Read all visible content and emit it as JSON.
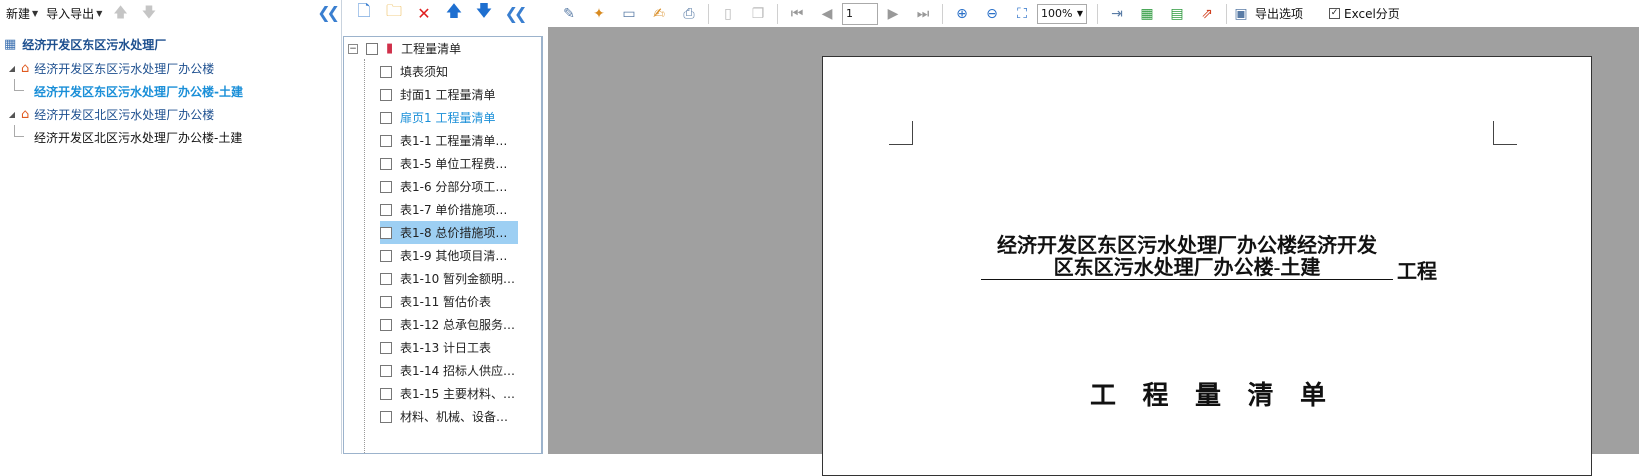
{
  "left": {
    "toolbar": {
      "new_label": "新建",
      "import_export_label": "导入导出"
    },
    "tree": {
      "root": "经济开发区东区污水处理厂",
      "items": [
        {
          "label": "经济开发区东区污水处理厂办公楼"
        },
        {
          "label": "经济开发区东区污水处理厂办公楼-土建"
        },
        {
          "label": "经济开发区北区污水处理厂办公楼"
        },
        {
          "label": "经济开发区北区污水处理厂办公楼-土建"
        }
      ]
    }
  },
  "middle": {
    "root_label": "工程量清单",
    "items": [
      "填表须知",
      "封面1 工程量清单",
      "扉页1 工程量清单",
      "表1-1 工程量清单…",
      "表1-5 单位工程费…",
      "表1-6 分部分项工…",
      "表1-7 单价措施项…",
      "表1-8 总价措施项…",
      "表1-9 其他项目清…",
      "表1-10 暂列金额明…",
      "表1-11 暂估价表",
      "表1-12 总承包服务…",
      "表1-13 计日工表",
      "表1-14 招标人供应…",
      "表1-15 主要材料、…",
      "材料、机械、设备…"
    ]
  },
  "right": {
    "toolbar": {
      "page_value": "1",
      "zoom_value": "100%",
      "export_options_label": "导出选项",
      "excel_paging_label": "Excel分页"
    },
    "document": {
      "title_line1": "经济开发区东区污水处理厂办公楼经济开发",
      "title_line2": "区东区污水处理厂办公楼-土建",
      "title_suffix": "工程",
      "heading": "工 程 量 清 单"
    }
  },
  "colors": {
    "accent": "#1a7fc0",
    "selected_row": "#9dcff3",
    "link_blue": "#1a8fd8"
  }
}
